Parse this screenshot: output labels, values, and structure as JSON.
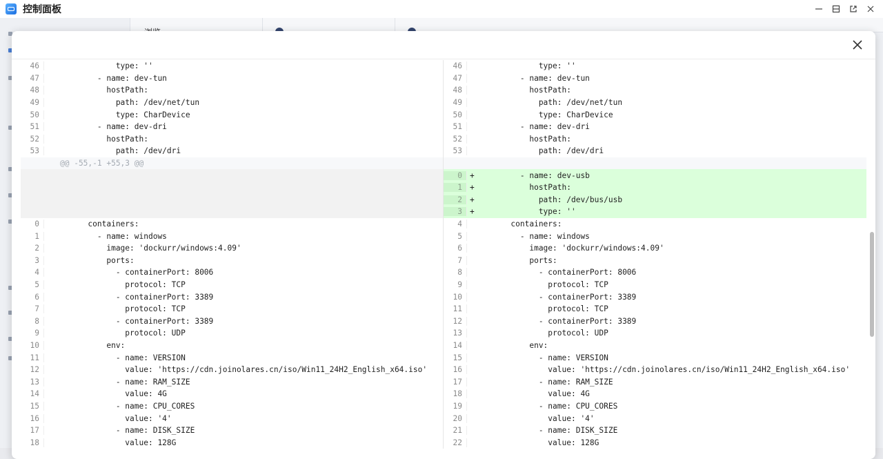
{
  "window": {
    "title": "控制面板"
  },
  "background_tabs": [
    {
      "label": "浏览"
    },
    {
      "label": ""
    },
    {
      "label": ""
    }
  ],
  "modal": {
    "hunk_header": "@@ -55,-1 +55,3 @@",
    "left_lines": [
      {
        "n": "46",
        "t": "            type: ''"
      },
      {
        "n": "47",
        "t": "        - name: dev-tun"
      },
      {
        "n": "48",
        "t": "          hostPath:"
      },
      {
        "n": "49",
        "t": "            path: /dev/net/tun"
      },
      {
        "n": "50",
        "t": "            type: CharDevice"
      },
      {
        "n": "51",
        "t": "        - name: dev-dri"
      },
      {
        "n": "52",
        "t": "          hostPath:"
      },
      {
        "n": "53",
        "t": "            path: /dev/dri"
      }
    ],
    "left_lines_after": [
      {
        "n": "0",
        "t": "      containers:"
      },
      {
        "n": "1",
        "t": "        - name: windows"
      },
      {
        "n": "2",
        "t": "          image: 'dockurr/windows:4.09'"
      },
      {
        "n": "3",
        "t": "          ports:"
      },
      {
        "n": "4",
        "t": "            - containerPort: 8006"
      },
      {
        "n": "5",
        "t": "              protocol: TCP"
      },
      {
        "n": "6",
        "t": "            - containerPort: 3389"
      },
      {
        "n": "7",
        "t": "              protocol: TCP"
      },
      {
        "n": "8",
        "t": "            - containerPort: 3389"
      },
      {
        "n": "9",
        "t": "              protocol: UDP"
      },
      {
        "n": "10",
        "t": "          env:"
      },
      {
        "n": "11",
        "t": "            - name: VERSION"
      },
      {
        "n": "12",
        "t": "              value: 'https://cdn.joinolares.cn/iso/Win11_24H2_English_x64.iso'"
      },
      {
        "n": "13",
        "t": "            - name: RAM_SIZE"
      },
      {
        "n": "14",
        "t": "              value: 4G"
      },
      {
        "n": "15",
        "t": "            - name: CPU_CORES"
      },
      {
        "n": "16",
        "t": "              value: '4'"
      },
      {
        "n": "17",
        "t": "            - name: DISK_SIZE"
      },
      {
        "n": "18",
        "t": "              value: 128G"
      }
    ],
    "right_lines": [
      {
        "n": "46",
        "t": "            type: ''"
      },
      {
        "n": "47",
        "t": "        - name: dev-tun"
      },
      {
        "n": "48",
        "t": "          hostPath:"
      },
      {
        "n": "49",
        "t": "            path: /dev/net/tun"
      },
      {
        "n": "50",
        "t": "            type: CharDevice"
      },
      {
        "n": "51",
        "t": "        - name: dev-dri"
      },
      {
        "n": "52",
        "t": "          hostPath:"
      },
      {
        "n": "53",
        "t": "            path: /dev/dri"
      }
    ],
    "right_added": [
      {
        "n": "0",
        "s": "+",
        "t": "        - name: dev-usb"
      },
      {
        "n": "1",
        "s": "+",
        "t": "          hostPath:"
      },
      {
        "n": "2",
        "s": "+",
        "t": "            path: /dev/bus/usb"
      },
      {
        "n": "3",
        "s": "+",
        "t": "            type: ''"
      }
    ],
    "right_lines_after": [
      {
        "n": "4",
        "t": "      containers:"
      },
      {
        "n": "5",
        "t": "        - name: windows"
      },
      {
        "n": "6",
        "t": "          image: 'dockurr/windows:4.09'"
      },
      {
        "n": "7",
        "t": "          ports:"
      },
      {
        "n": "8",
        "t": "            - containerPort: 8006"
      },
      {
        "n": "9",
        "t": "              protocol: TCP"
      },
      {
        "n": "10",
        "t": "            - containerPort: 3389"
      },
      {
        "n": "11",
        "t": "              protocol: TCP"
      },
      {
        "n": "12",
        "t": "            - containerPort: 3389"
      },
      {
        "n": "13",
        "t": "              protocol: UDP"
      },
      {
        "n": "14",
        "t": "          env:"
      },
      {
        "n": "15",
        "t": "            - name: VERSION"
      },
      {
        "n": "16",
        "t": "              value: 'https://cdn.joinolares.cn/iso/Win11_24H2_English_x64.iso'"
      },
      {
        "n": "17",
        "t": "            - name: RAM_SIZE"
      },
      {
        "n": "18",
        "t": "              value: 4G"
      },
      {
        "n": "19",
        "t": "            - name: CPU_CORES"
      },
      {
        "n": "20",
        "t": "              value: '4'"
      },
      {
        "n": "21",
        "t": "            - name: DISK_SIZE"
      },
      {
        "n": "22",
        "t": "              value: 128G"
      }
    ]
  },
  "colors": {
    "added_bg": "#dbffdb",
    "empty_bg": "#f2f2f2",
    "hunk_text": "#a5abb3"
  },
  "icons": {
    "app": "control-panel-icon",
    "minimize": "minimize-icon",
    "maximize": "maximize-icon",
    "popout": "popout-icon",
    "close_window": "close-icon",
    "close_modal": "close-icon"
  }
}
